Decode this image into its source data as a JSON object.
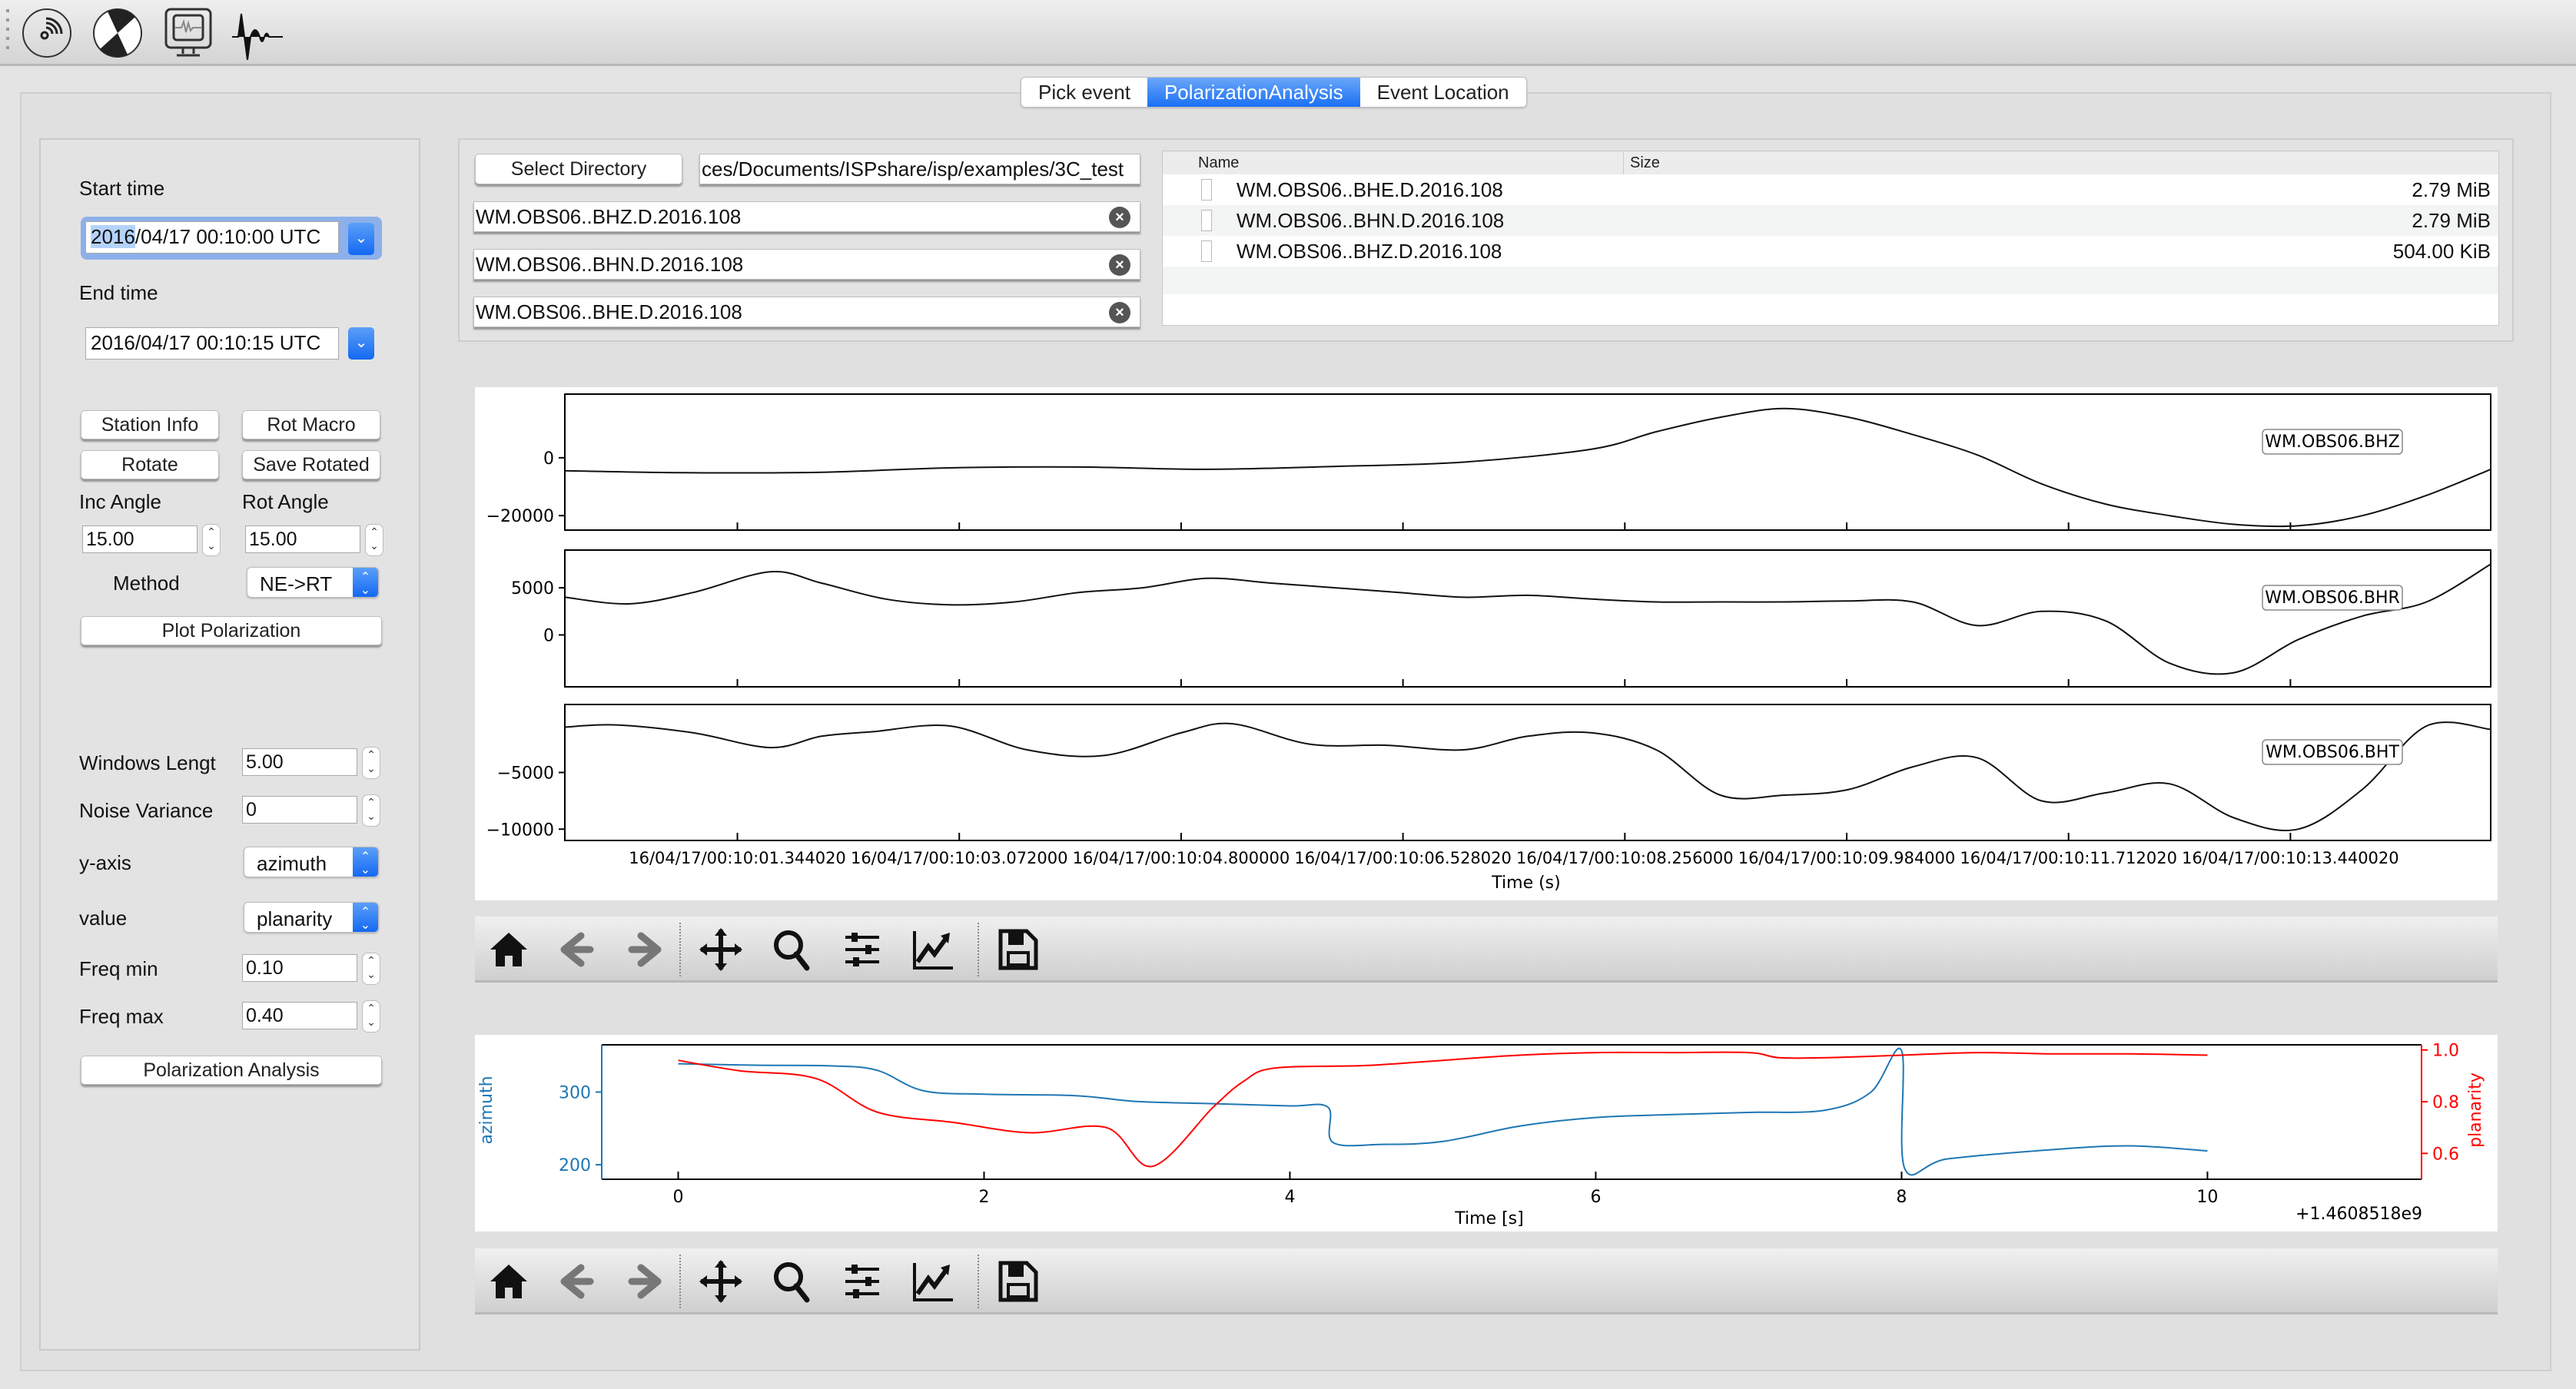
{
  "toolbar": {
    "icons": [
      "seismometer-icon",
      "beachball-icon",
      "monitor-waveform-icon",
      "seismogram-icon"
    ]
  },
  "tabs": [
    {
      "label": "Pick event",
      "active": false
    },
    {
      "label": "PolarizationAnalysis",
      "active": true
    },
    {
      "label": "Event Location",
      "active": false
    }
  ],
  "left_panel": {
    "start_time_label": "Start time",
    "start_time_selected": "2016",
    "start_time_rest": "/04/17 00:10:00 UTC",
    "end_time_label": "End time",
    "end_time_value": "2016/04/17 00:10:15 UTC",
    "station_info_button": "Station Info",
    "rot_macro_button": "Rot Macro",
    "rotate_button": "Rotate",
    "save_rotated_button": "Save Rotated",
    "inc_angle_label": "Inc Angle",
    "inc_angle_value": "15.00",
    "rot_angle_label": "Rot Angle",
    "rot_angle_value": "15.00",
    "method_label": "Method",
    "method_value": "NE->RT",
    "plot_polarization_button": "Plot Polarization",
    "window_length_label": "Windows Lengt",
    "window_length_value": "5.00",
    "noise_variance_label": "Noise Variance",
    "noise_variance_value": "0",
    "y_axis_label": "y-axis",
    "y_axis_value": "azimuth",
    "value_label": "value",
    "value_value": "planarity",
    "freq_min_label": "Freq min",
    "freq_min_value": "0.10",
    "freq_max_label": "Freq max",
    "freq_max_value": "0.40",
    "polarization_analysis_button": "Polarization Analysis"
  },
  "files": {
    "select_directory_button": "Select Directory",
    "directory_path": "ces/Documents/ISPshare/isp/examples/3C_test",
    "file_inputs": [
      "WM.OBS06..BHZ.D.2016.108",
      "WM.OBS06..BHN.D.2016.108",
      "WM.OBS06..BHE.D.2016.108"
    ],
    "table": {
      "columns": [
        "Name",
        "Size"
      ],
      "rows": [
        {
          "name": "WM.OBS06..BHE.D.2016.108",
          "size": "2.79 MiB"
        },
        {
          "name": "WM.OBS06..BHN.D.2016.108",
          "size": "2.79 MiB"
        },
        {
          "name": "WM.OBS06..BHZ.D.2016.108",
          "size": "504.00 KiB"
        }
      ]
    }
  },
  "plot_toolbar": {
    "tools": [
      "home-icon",
      "back-arrow-icon",
      "forward-arrow-icon",
      "pan-icon",
      "zoom-icon",
      "configure-subplots-icon",
      "edit-axis-icon",
      "save-icon"
    ]
  },
  "chart_data": [
    {
      "type": "line",
      "title": "",
      "xlabel": "Time (s)",
      "x_tick_labels": [
        "16/04/17/00:10:01.344020",
        "16/04/17/00:10:03.072000",
        "16/04/17/00:10:04.800000",
        "16/04/17/00:10:06.528020",
        "16/04/17/00:10:08.256000",
        "16/04/17/00:10:09.984000",
        "16/04/17/00:10:11.712020",
        "16/04/17/00:10:13.440020"
      ],
      "x_ticks_s": [
        1.344,
        3.072,
        4.8,
        6.528,
        8.256,
        9.984,
        11.712,
        13.44
      ],
      "xlim_s": [
        0,
        15
      ],
      "series": [
        {
          "name": "WM.OBS06.BHZ",
          "ylim": [
            -25000,
            22000
          ],
          "y_ticks": [
            0,
            -20000
          ],
          "y_tick_labels": [
            "0",
            "−20000"
          ],
          "x": [
            0,
            1,
            2,
            3,
            4,
            5,
            6,
            7,
            8,
            8.5,
            9.0,
            9.5,
            10.0,
            10.5,
            11.0,
            11.5,
            12.0,
            12.5,
            13.0,
            13.5,
            14.0,
            14.5,
            15.0
          ],
          "values": [
            -4500,
            -5200,
            -5000,
            -3500,
            -3200,
            -4000,
            -3000,
            -1500,
            3000,
            9000,
            14000,
            17000,
            14000,
            8000,
            1000,
            -9000,
            -16000,
            -20000,
            -23000,
            -23500,
            -20000,
            -13000,
            -4000
          ]
        },
        {
          "name": "WM.OBS06.BHR",
          "ylim": [
            -5500,
            9000
          ],
          "y_ticks": [
            5000,
            0
          ],
          "y_tick_labels": [
            "5000",
            "0"
          ],
          "x": [
            0,
            0.5,
            1.0,
            1.6,
            2.0,
            2.5,
            3.0,
            3.5,
            4.0,
            4.5,
            5.0,
            5.5,
            6.0,
            6.5,
            7.0,
            7.5,
            8.0,
            8.5,
            9.0,
            9.5,
            10.0,
            10.5,
            11.0,
            11.5,
            12.0,
            12.5,
            13.0,
            13.5,
            14.0,
            14.5,
            15.0
          ],
          "values": [
            4000,
            3300,
            4500,
            6700,
            5500,
            3800,
            3200,
            3500,
            4500,
            5000,
            6000,
            5500,
            5000,
            4500,
            4000,
            4200,
            3800,
            3500,
            3500,
            3500,
            3600,
            3500,
            1000,
            2500,
            1500,
            -3000,
            -4000,
            -500,
            2000,
            3500,
            7500
          ]
        },
        {
          "name": "WM.OBS06.BHT",
          "ylim": [
            -11000,
            1000
          ],
          "y_ticks": [
            -5000,
            -10000
          ],
          "y_tick_labels": [
            "−5000",
            "−10000"
          ],
          "x": [
            0,
            0.4,
            1.0,
            1.6,
            2.0,
            2.4,
            3.0,
            3.6,
            4.2,
            4.8,
            5.2,
            5.8,
            6.4,
            7.0,
            7.5,
            8.0,
            8.5,
            9.0,
            9.5,
            10.0,
            10.5,
            11.0,
            11.5,
            12.0,
            12.5,
            13.0,
            13.5,
            14.0,
            14.5,
            15.0
          ],
          "values": [
            -1000,
            -800,
            -1500,
            -2800,
            -1800,
            -1400,
            -900,
            -3000,
            -3500,
            -1500,
            -700,
            -2500,
            -2600,
            -3000,
            -1800,
            -1500,
            -3000,
            -7000,
            -7000,
            -6500,
            -4500,
            -3700,
            -7500,
            -6800,
            -6000,
            -9000,
            -10000,
            -6500,
            -900,
            -1200
          ]
        }
      ]
    },
    {
      "type": "line",
      "title": "",
      "xlabel": "Time [s]",
      "x_offset_label": "+1.4608518e9",
      "x_ticks": [
        0,
        2,
        4,
        6,
        8,
        10
      ],
      "xlim": [
        -0.5,
        11.4
      ],
      "y_left": {
        "label": "azimuth",
        "ticks": [
          300,
          200
        ],
        "lim": [
          180,
          365
        ],
        "color": "#1f77b4"
      },
      "y_right": {
        "label": "planarity",
        "ticks": [
          1.0,
          0.8,
          0.6
        ],
        "tick_labels": [
          "1.0",
          "0.8",
          "0.6"
        ],
        "lim": [
          0.5,
          1.02
        ],
        "color": "#ff0000"
      },
      "series": [
        {
          "name": "azimuth",
          "axis": "left",
          "color": "#1f77b4",
          "x": [
            0,
            0.5,
            1.0,
            1.3,
            1.6,
            2.0,
            2.6,
            3.0,
            3.5,
            4.0,
            4.25,
            4.28,
            4.6,
            5.0,
            5.5,
            6.0,
            6.5,
            7.0,
            7.5,
            7.8,
            8.0,
            8.02,
            8.3,
            9.0,
            9.5,
            10.0
          ],
          "values": [
            339,
            337,
            336,
            330,
            302,
            297,
            295,
            287,
            284,
            281,
            279,
            231,
            228,
            232,
            253,
            265,
            269,
            272,
            275,
            300,
            357,
            195,
            208,
            221,
            226,
            219
          ]
        },
        {
          "name": "planarity",
          "axis": "right",
          "color": "#ff0000",
          "x": [
            0,
            0.4,
            0.9,
            1.3,
            1.8,
            2.3,
            2.8,
            3.1,
            3.5,
            3.7,
            3.9,
            4.5,
            5.0,
            5.5,
            6.0,
            6.5,
            7.0,
            7.2,
            7.5,
            8.0,
            8.5,
            9.0,
            9.5,
            10.0
          ],
          "values": [
            0.96,
            0.92,
            0.89,
            0.76,
            0.72,
            0.68,
            0.7,
            0.55,
            0.78,
            0.88,
            0.93,
            0.94,
            0.96,
            0.98,
            0.99,
            0.99,
            0.99,
            0.97,
            0.97,
            0.98,
            0.99,
            0.985,
            0.985,
            0.98
          ]
        }
      ]
    }
  ]
}
